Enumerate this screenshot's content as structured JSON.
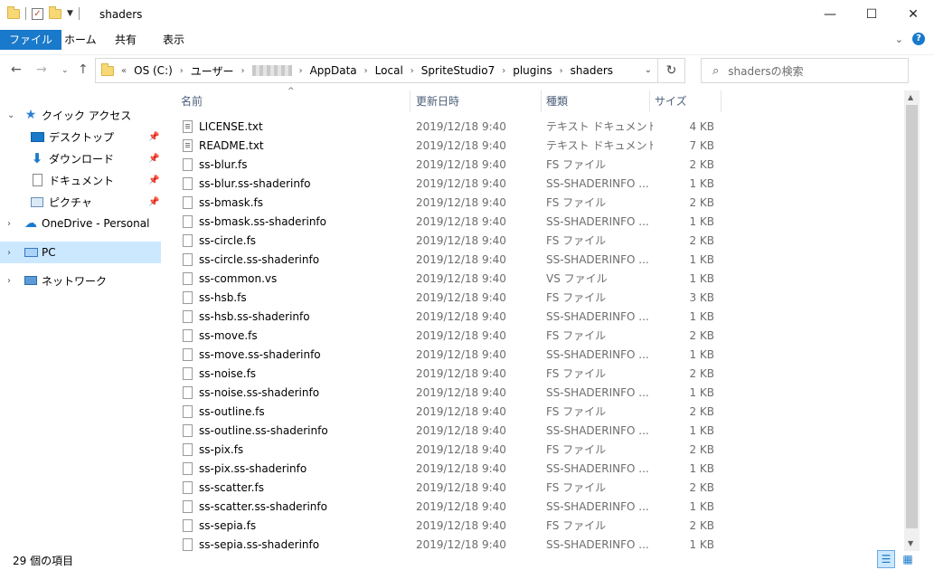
{
  "window": {
    "title": "shaders",
    "minimize": "—",
    "maximize": "☐",
    "close": "✕"
  },
  "ribbon": {
    "tabs": [
      {
        "label": "ファイル",
        "active": true
      },
      {
        "label": "ホーム",
        "active": false
      },
      {
        "label": "共有",
        "active": false
      },
      {
        "label": "表示",
        "active": false
      }
    ],
    "help": "?"
  },
  "address": {
    "overflow": "«",
    "crumbs": [
      "OS (C:)",
      "ユーザー",
      "AppData",
      "Local",
      "SpriteStudio7",
      "plugins",
      "shaders"
    ]
  },
  "search": {
    "placeholder": "shadersの検索"
  },
  "nav": {
    "items": [
      {
        "label": "クイック アクセス",
        "icon": "star-icon",
        "expander": "⌄"
      },
      {
        "label": "デスクトップ",
        "icon": "desktop-icon",
        "pinned": true
      },
      {
        "label": "ダウンロード",
        "icon": "download-icon",
        "pinned": true
      },
      {
        "label": "ドキュメント",
        "icon": "document-icon",
        "pinned": true
      },
      {
        "label": "ピクチャ",
        "icon": "pictures-icon",
        "pinned": true
      },
      {
        "label": "OneDrive - Personal",
        "icon": "cloud-icon",
        "expander": "›"
      },
      {
        "label": "PC",
        "icon": "pc-icon",
        "expander": "›",
        "selected": true
      },
      {
        "label": "ネットワーク",
        "icon": "network-icon",
        "expander": "›"
      }
    ]
  },
  "columns": {
    "name": "名前",
    "date": "更新日時",
    "type": "種類",
    "size": "サイズ"
  },
  "files": [
    {
      "name": "LICENSE.txt",
      "date": "2019/12/18 9:40",
      "type": "テキスト ドキュメント",
      "size": "4 KB",
      "icon": "text-file-icon"
    },
    {
      "name": "README.txt",
      "date": "2019/12/18 9:40",
      "type": "テキスト ドキュメント",
      "size": "7 KB",
      "icon": "text-file-icon"
    },
    {
      "name": "ss-blur.fs",
      "date": "2019/12/18 9:40",
      "type": "FS ファイル",
      "size": "2 KB",
      "icon": "file-icon"
    },
    {
      "name": "ss-blur.ss-shaderinfo",
      "date": "2019/12/18 9:40",
      "type": "SS-SHADERINFO ...",
      "size": "1 KB",
      "icon": "file-icon"
    },
    {
      "name": "ss-bmask.fs",
      "date": "2019/12/18 9:40",
      "type": "FS ファイル",
      "size": "2 KB",
      "icon": "file-icon"
    },
    {
      "name": "ss-bmask.ss-shaderinfo",
      "date": "2019/12/18 9:40",
      "type": "SS-SHADERINFO ...",
      "size": "1 KB",
      "icon": "file-icon"
    },
    {
      "name": "ss-circle.fs",
      "date": "2019/12/18 9:40",
      "type": "FS ファイル",
      "size": "2 KB",
      "icon": "file-icon"
    },
    {
      "name": "ss-circle.ss-shaderinfo",
      "date": "2019/12/18 9:40",
      "type": "SS-SHADERINFO ...",
      "size": "1 KB",
      "icon": "file-icon"
    },
    {
      "name": "ss-common.vs",
      "date": "2019/12/18 9:40",
      "type": "VS ファイル",
      "size": "1 KB",
      "icon": "file-icon"
    },
    {
      "name": "ss-hsb.fs",
      "date": "2019/12/18 9:40",
      "type": "FS ファイル",
      "size": "3 KB",
      "icon": "file-icon"
    },
    {
      "name": "ss-hsb.ss-shaderinfo",
      "date": "2019/12/18 9:40",
      "type": "SS-SHADERINFO ...",
      "size": "1 KB",
      "icon": "file-icon"
    },
    {
      "name": "ss-move.fs",
      "date": "2019/12/18 9:40",
      "type": "FS ファイル",
      "size": "2 KB",
      "icon": "file-icon"
    },
    {
      "name": "ss-move.ss-shaderinfo",
      "date": "2019/12/18 9:40",
      "type": "SS-SHADERINFO ...",
      "size": "1 KB",
      "icon": "file-icon"
    },
    {
      "name": "ss-noise.fs",
      "date": "2019/12/18 9:40",
      "type": "FS ファイル",
      "size": "2 KB",
      "icon": "file-icon"
    },
    {
      "name": "ss-noise.ss-shaderinfo",
      "date": "2019/12/18 9:40",
      "type": "SS-SHADERINFO ...",
      "size": "1 KB",
      "icon": "file-icon"
    },
    {
      "name": "ss-outline.fs",
      "date": "2019/12/18 9:40",
      "type": "FS ファイル",
      "size": "2 KB",
      "icon": "file-icon"
    },
    {
      "name": "ss-outline.ss-shaderinfo",
      "date": "2019/12/18 9:40",
      "type": "SS-SHADERINFO ...",
      "size": "1 KB",
      "icon": "file-icon"
    },
    {
      "name": "ss-pix.fs",
      "date": "2019/12/18 9:40",
      "type": "FS ファイル",
      "size": "2 KB",
      "icon": "file-icon"
    },
    {
      "name": "ss-pix.ss-shaderinfo",
      "date": "2019/12/18 9:40",
      "type": "SS-SHADERINFO ...",
      "size": "1 KB",
      "icon": "file-icon"
    },
    {
      "name": "ss-scatter.fs",
      "date": "2019/12/18 9:40",
      "type": "FS ファイル",
      "size": "2 KB",
      "icon": "file-icon"
    },
    {
      "name": "ss-scatter.ss-shaderinfo",
      "date": "2019/12/18 9:40",
      "type": "SS-SHADERINFO ...",
      "size": "1 KB",
      "icon": "file-icon"
    },
    {
      "name": "ss-sepia.fs",
      "date": "2019/12/18 9:40",
      "type": "FS ファイル",
      "size": "2 KB",
      "icon": "file-icon"
    },
    {
      "name": "ss-sepia.ss-shaderinfo",
      "date": "2019/12/18 9:40",
      "type": "SS-SHADERINFO ...",
      "size": "1 KB",
      "icon": "file-icon"
    }
  ],
  "status": {
    "count": "29 個の項目"
  },
  "colors": {
    "accent": "#1979ca",
    "selection": "#cce8ff",
    "muted_text": "#6d6d6d",
    "header_text": "#4c607a"
  }
}
